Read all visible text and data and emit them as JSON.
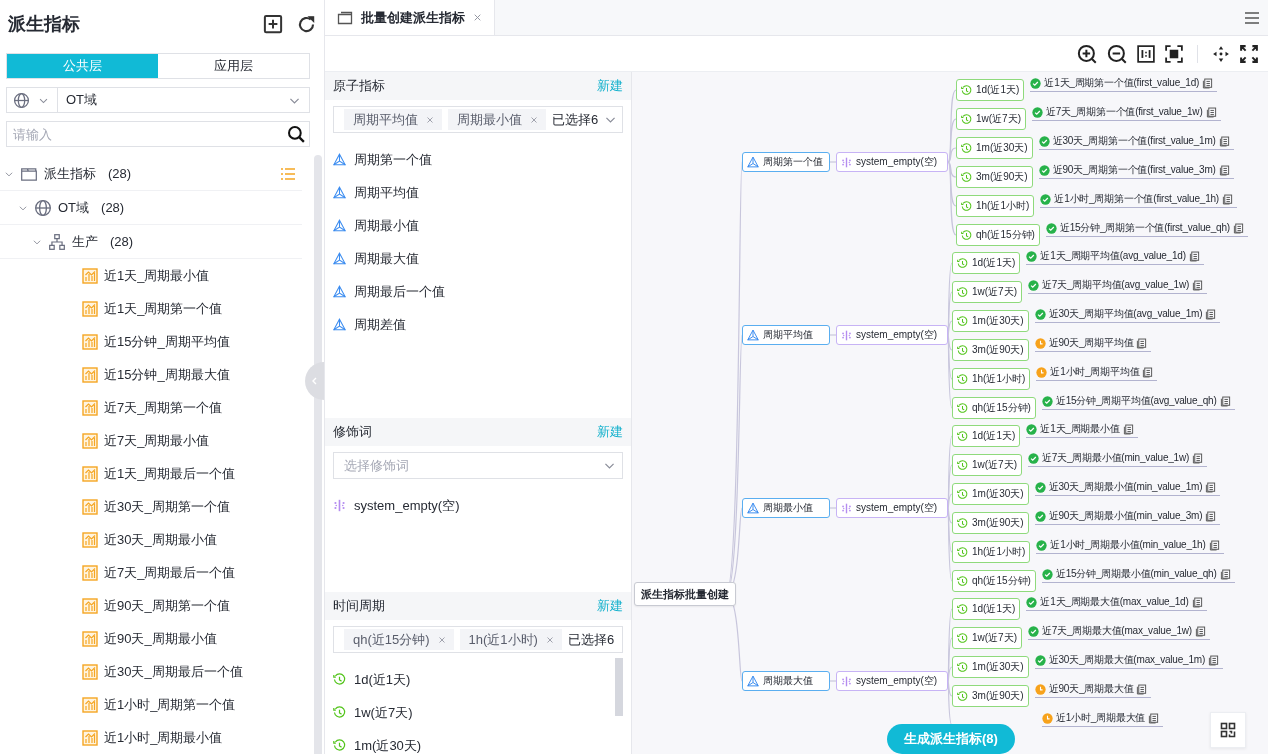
{
  "sidebar": {
    "title": "派生指标",
    "tabs": [
      {
        "label": "公共层",
        "selected": true
      },
      {
        "label": "应用层",
        "selected": false
      }
    ],
    "domain_select": {
      "value": "OT域"
    },
    "search": {
      "placeholder": "请输入"
    },
    "tree": [
      {
        "kind": "folder",
        "label": "派生指标",
        "count": "(28)",
        "expanded": true,
        "children": [
          {
            "kind": "domain",
            "label": "OT域",
            "count": "(28)",
            "expanded": true,
            "children": [
              {
                "kind": "category",
                "label": "生产",
                "count": "(28)",
                "expanded": true,
                "children": [
                  {
                    "kind": "metric",
                    "label": "近1天_周期最小值"
                  },
                  {
                    "kind": "metric",
                    "label": "近1天_周期第一个值"
                  },
                  {
                    "kind": "metric",
                    "label": "近15分钟_周期平均值"
                  },
                  {
                    "kind": "metric",
                    "label": "近15分钟_周期最大值"
                  },
                  {
                    "kind": "metric",
                    "label": "近7天_周期第一个值"
                  },
                  {
                    "kind": "metric",
                    "label": "近7天_周期最小值"
                  },
                  {
                    "kind": "metric",
                    "label": "近1天_周期最后一个值"
                  },
                  {
                    "kind": "metric",
                    "label": "近30天_周期第一个值"
                  },
                  {
                    "kind": "metric",
                    "label": "近30天_周期最小值"
                  },
                  {
                    "kind": "metric",
                    "label": "近7天_周期最后一个值"
                  },
                  {
                    "kind": "metric",
                    "label": "近90天_周期第一个值"
                  },
                  {
                    "kind": "metric",
                    "label": "近90天_周期最小值"
                  },
                  {
                    "kind": "metric",
                    "label": "近30天_周期最后一个值"
                  },
                  {
                    "kind": "metric",
                    "label": "近1小时_周期第一个值"
                  },
                  {
                    "kind": "metric",
                    "label": "近1小时_周期最小值"
                  }
                ]
              }
            ]
          }
        ]
      }
    ]
  },
  "tabs": [
    {
      "label": "批量创建派生指标",
      "selected": true
    }
  ],
  "atomic_metrics": {
    "title": "原子指标",
    "new_link": "新建",
    "select": {
      "tags": [
        "周期平均值",
        "周期最小值"
      ],
      "summary": "已选择6"
    },
    "items": [
      "周期第一个值",
      "周期平均值",
      "周期最小值",
      "周期最大值",
      "周期最后一个值",
      "周期差值"
    ]
  },
  "modifiers": {
    "title": "修饰词",
    "new_link": "新建",
    "select": {
      "placeholder": "选择修饰词"
    },
    "items": [
      "system_empty(空)"
    ]
  },
  "time_periods": {
    "title": "时间周期",
    "new_link": "新建",
    "select": {
      "tags": [
        "qh(近15分钟)",
        "1h(近1小时)"
      ],
      "summary": "已选择6"
    },
    "items": [
      "1d(近1天)",
      "1w(近7天)",
      "1m(近30天)"
    ]
  },
  "mindmap": {
    "root": "派生指标批量创建",
    "branches": [
      {
        "atom": "周期第一个值",
        "modifier": "system_empty(空)",
        "periods": [
          {
            "period": "1d(近1天)",
            "done": true,
            "result": "近1天_周期第一个值(first_value_1d)"
          },
          {
            "period": "1w(近7天)",
            "done": true,
            "result": "近7天_周期第一个值(first_value_1w)"
          },
          {
            "period": "1m(近30天)",
            "done": true,
            "result": "近30天_周期第一个值(first_value_1m)"
          },
          {
            "period": "3m(近90天)",
            "done": true,
            "result": "近90天_周期第一个值(first_value_3m)"
          },
          {
            "period": "1h(近1小时)",
            "done": true,
            "result": "近1小时_周期第一个值(first_value_1h)"
          },
          {
            "period": "qh(近15分钟)",
            "done": true,
            "result": "近15分钟_周期第一个值(first_value_qh)"
          }
        ]
      },
      {
        "atom": "周期平均值",
        "modifier": "system_empty(空)",
        "periods": [
          {
            "period": "1d(近1天)",
            "done": true,
            "result": "近1天_周期平均值(avg_value_1d)"
          },
          {
            "period": "1w(近7天)",
            "done": true,
            "result": "近7天_周期平均值(avg_value_1w)"
          },
          {
            "period": "1m(近30天)",
            "done": true,
            "result": "近30天_周期平均值(avg_value_1m)"
          },
          {
            "period": "3m(近90天)",
            "done": false,
            "result": "近90天_周期平均值"
          },
          {
            "period": "1h(近1小时)",
            "done": false,
            "result": "近1小时_周期平均值"
          },
          {
            "period": "qh(近15分钟)",
            "done": true,
            "result": "近15分钟_周期平均值(avg_value_qh)"
          }
        ]
      },
      {
        "atom": "周期最小值",
        "modifier": "system_empty(空)",
        "periods": [
          {
            "period": "1d(近1天)",
            "done": true,
            "result": "近1天_周期最小值"
          },
          {
            "period": "1w(近7天)",
            "done": true,
            "result": "近7天_周期最小值(min_value_1w)"
          },
          {
            "period": "1m(近30天)",
            "done": true,
            "result": "近30天_周期最小值(min_value_1m)"
          },
          {
            "period": "3m(近90天)",
            "done": true,
            "result": "近90天_周期最小值(min_value_3m)"
          },
          {
            "period": "1h(近1小时)",
            "done": true,
            "result": "近1小时_周期最小值(min_value_1h)"
          },
          {
            "period": "qh(近15分钟)",
            "done": true,
            "result": "近15分钟_周期最小值(min_value_qh)"
          }
        ]
      },
      {
        "atom": "周期最大值",
        "modifier": "system_empty(空)",
        "periods": [
          {
            "period": "1d(近1天)",
            "done": true,
            "result": "近1天_周期最大值(max_value_1d)"
          },
          {
            "period": "1w(近7天)",
            "done": true,
            "result": "近7天_周期最大值(max_value_1w)"
          },
          {
            "period": "1m(近30天)",
            "done": true,
            "result": "近30天_周期最大值(max_value_1m)"
          },
          {
            "period": "3m(近90天)",
            "done": false,
            "result": "近90天_周期最大值"
          },
          {
            "done": false,
            "result": "近1小时_周期最大值"
          }
        ]
      }
    ]
  },
  "generate_button": "生成派生指标(8)"
}
